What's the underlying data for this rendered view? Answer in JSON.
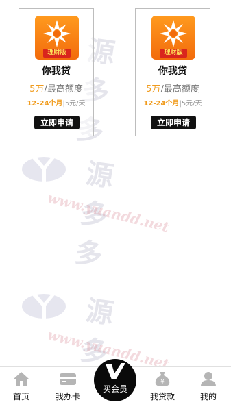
{
  "watermark": {
    "name": "源多多",
    "brand": "YUANDD.NET",
    "url": "www.yuandd.net"
  },
  "products": [
    {
      "logo_label": "理财版",
      "name": "你我贷",
      "amount": "5万",
      "limit_suffix": "/最高额度",
      "term": "12-24个月",
      "separator": "|",
      "rate": "5元/天",
      "apply_label": "立即申请"
    },
    {
      "logo_label": "理财版",
      "name": "你我贷",
      "amount": "5万",
      "limit_suffix": "/最高额度",
      "term": "12-24个月",
      "separator": "|",
      "rate": "5元/天",
      "apply_label": "立即申请"
    }
  ],
  "tabbar": {
    "home": "首页",
    "card": "我办卡",
    "vip": "买会员",
    "loan": "我贷款",
    "mine": "我的"
  },
  "colors": {
    "accent": "#f09c1f",
    "logo_orange": "#f26b0c",
    "label_red": "#d9251d",
    "button": "#111111"
  },
  "icons": {
    "home": "home-icon",
    "card": "credit-card-icon",
    "vip": "vip-v-icon",
    "loan": "money-bag-icon",
    "mine": "user-icon"
  }
}
